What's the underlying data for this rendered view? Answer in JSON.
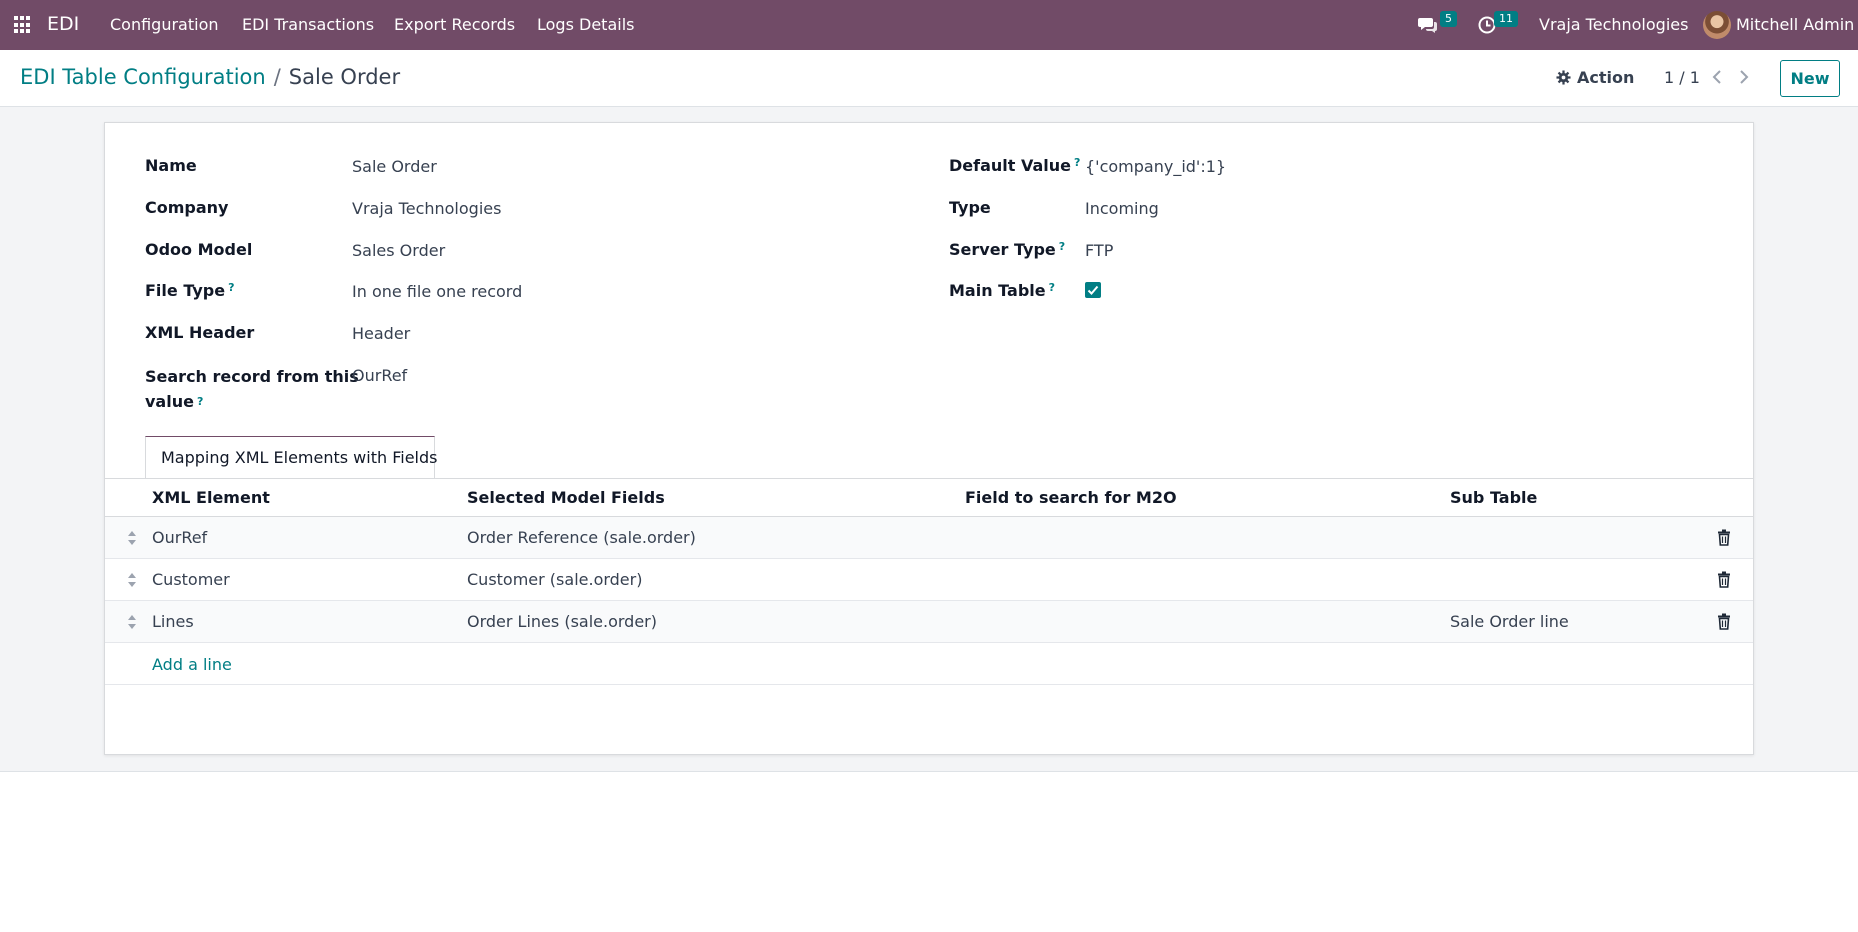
{
  "navbar": {
    "brand": "EDI",
    "menu": [
      "Configuration",
      "EDI Transactions",
      "Export Records",
      "Logs Details"
    ],
    "messages_count": "5",
    "activities_count": "11",
    "company": "Vraja Technologies",
    "user": "Mitchell Admin"
  },
  "control_panel": {
    "breadcrumb_parent": "EDI Table Configuration",
    "breadcrumb_separator": "/",
    "breadcrumb_current": "Sale Order",
    "action_label": "Action",
    "pager": "1 / 1",
    "new_label": "New"
  },
  "form": {
    "left": [
      {
        "label": "Name",
        "value": "Sale Order",
        "help": ""
      },
      {
        "label": "Company",
        "value": "Vraja Technologies",
        "help": ""
      },
      {
        "label": "Odoo Model",
        "value": "Sales Order",
        "help": ""
      },
      {
        "label": "File Type",
        "value": "In one file one record",
        "help": "?"
      },
      {
        "label": "XML Header",
        "value": "Header",
        "help": ""
      },
      {
        "label_line1": "Search record from this",
        "label_line2": "value",
        "value": "OurRef",
        "help": "?"
      }
    ],
    "right": [
      {
        "label": "Default Value",
        "value": "{'company_id':1}",
        "help": "?"
      },
      {
        "label": "Type",
        "value": "Incoming",
        "help": ""
      },
      {
        "label": "Server Type",
        "value": "FTP",
        "help": "?"
      },
      {
        "label": "Main Table",
        "value": true,
        "help": "?"
      }
    ]
  },
  "notebook": {
    "tab_label": "Mapping XML Elements with Fields",
    "columns": [
      "XML Element",
      "Selected Model Fields",
      "Field to search for M2O",
      "Sub Table"
    ],
    "rows": [
      {
        "xml_element": "OurRef",
        "model_field": "Order Reference (sale.order)",
        "m2o_field": "",
        "sub_table": ""
      },
      {
        "xml_element": "Customer",
        "model_field": "Customer (sale.order)",
        "m2o_field": "",
        "sub_table": ""
      },
      {
        "xml_element": "Lines",
        "model_field": "Order Lines (sale.order)",
        "m2o_field": "",
        "sub_table": "Sale Order line"
      }
    ],
    "add_line_label": "Add a line"
  },
  "colors": {
    "navbar": "#714b67",
    "accent": "#017e84"
  }
}
